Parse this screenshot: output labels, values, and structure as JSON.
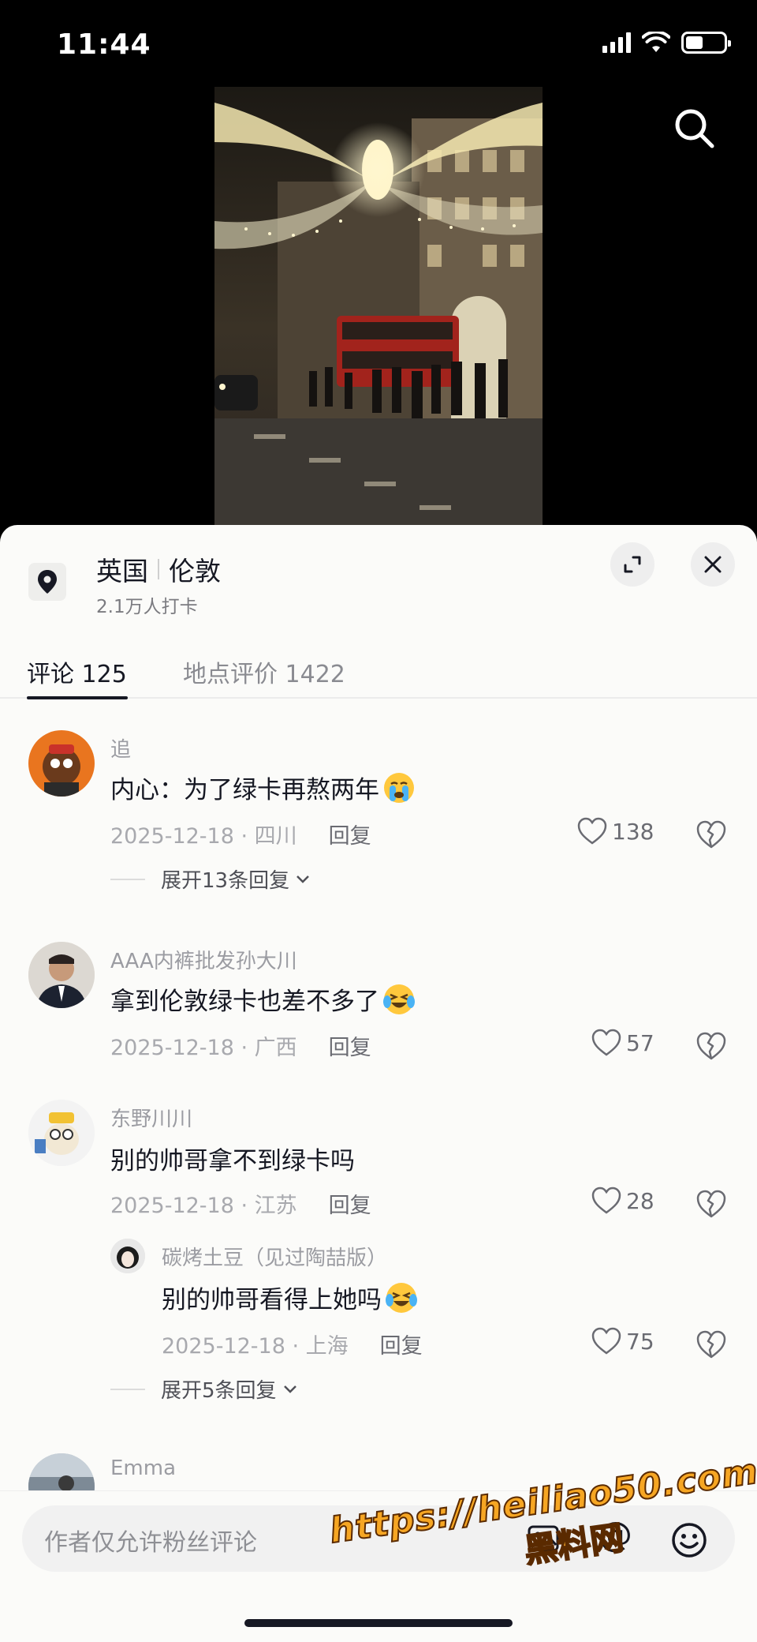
{
  "status_bar": {
    "time": "11:44"
  },
  "location": {
    "country": "英国",
    "city": "伦敦",
    "checkins": "2.1万人打卡"
  },
  "tabs": [
    {
      "label": "评论 125",
      "active": true
    },
    {
      "label": "地点评价 1422",
      "active": false
    }
  ],
  "comments": [
    {
      "user": "追",
      "text": "内心：为了绿卡再熬两年",
      "emoji": "crying-face",
      "date_place": "2025-12-18 · 四川",
      "reply": "回复",
      "likes": "138",
      "expand": "展开13条回复"
    },
    {
      "user": "AAA内裤批发孙大川",
      "text": "拿到伦敦绿卡也差不多了",
      "emoji": "laugh-crying-face",
      "date_place": "2025-12-18 · 广西",
      "reply": "回复",
      "likes": "57"
    },
    {
      "user": "东野川川",
      "text": "别的帅哥拿不到绿卡吗",
      "date_place": "2025-12-18 · 江苏",
      "reply": "回复",
      "likes": "28",
      "sub_reply": {
        "user": "碳烤土豆（见过陶喆版）",
        "text": "别的帅哥看得上她吗",
        "emoji": "laugh-crying-face",
        "date_place": "2025-12-18 · 上海",
        "reply": "回复",
        "likes": "75"
      },
      "expand": "展开5条回复"
    },
    {
      "user": "Emma"
    }
  ],
  "input": {
    "placeholder": "作者仅允许粉丝评论"
  },
  "watermark": {
    "url": "https://heiliao50.com",
    "name": "黑料网"
  },
  "colors": {
    "accent_text": "#161823",
    "muted": "#9b9ca2",
    "sheet_bg": "#fbfbf9",
    "watermark": "#f6a623"
  }
}
